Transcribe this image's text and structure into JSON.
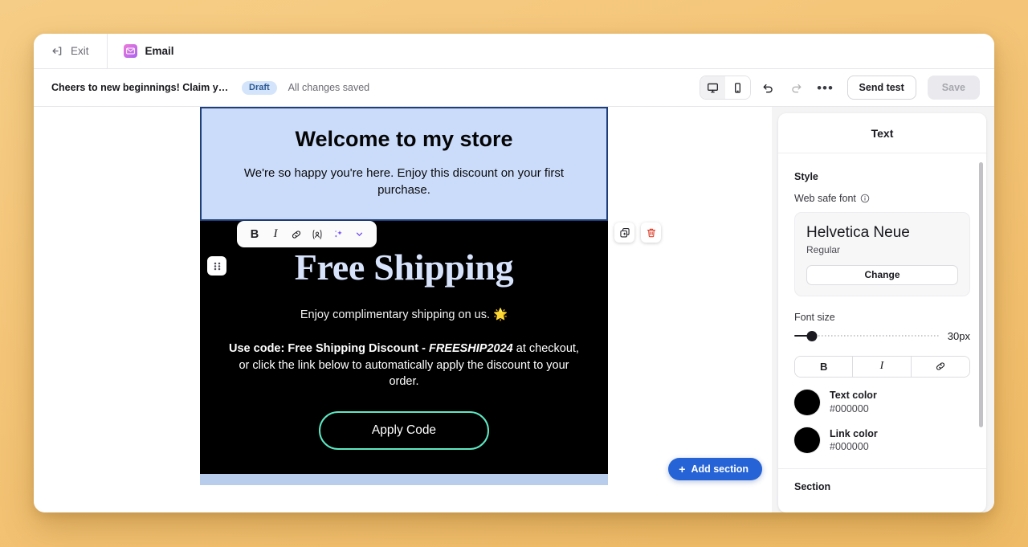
{
  "window": {
    "tabs": {
      "exit_label": "Exit",
      "email_label": "Email"
    },
    "subbar": {
      "subject": "Cheers to new beginnings! Claim yo...",
      "status_badge": "Draft",
      "save_state": "All changes saved",
      "send_test_label": "Send test",
      "save_label": "Save",
      "more_label": "•••"
    }
  },
  "format_toolbar": {
    "bold": "B",
    "italic": "I",
    "link": "link-icon",
    "personalize": "{x}",
    "ai": "sparkle-icon",
    "chevron": "⌄"
  },
  "canvas": {
    "hero": {
      "heading": "Welcome to my store",
      "paragraph": "We're so happy you're here. Enjoy this discount on your first purchase.",
      "background": "#cbdcfb"
    },
    "promo": {
      "heading": "Free Shipping",
      "subheading": "Enjoy complimentary shipping on us. 🌟",
      "body_lead": "Use code: Free Shipping Discount - ",
      "body_code": "FREESHIP2024",
      "body_tail": " at checkout, or click the link below to automatically apply the discount to your order.",
      "cta_label": "Apply Code",
      "background": "#000000",
      "cta_border": "#5de9c3",
      "heading_color": "#d7e2fb"
    },
    "add_section_label": "Add section",
    "add_section_plus": "+",
    "section_actions": {
      "duplicate": "duplicate-icon",
      "delete": "trash-icon"
    },
    "drag_handle": "drag-handle-icon"
  },
  "right_panel": {
    "title": "Text",
    "style_label": "Style",
    "web_safe_font_label": "Web safe font",
    "font": {
      "name": "Helvetica Neue",
      "weight": "Regular",
      "change_label": "Change"
    },
    "font_size": {
      "label": "Font size",
      "value": "30px"
    },
    "format_buttons": {
      "bold": "B",
      "italic": "I",
      "link": "link-icon"
    },
    "colors": [
      {
        "name": "Text color",
        "hex": "#000000"
      },
      {
        "name": "Link color",
        "hex": "#000000"
      }
    ],
    "section_label": "Section"
  }
}
